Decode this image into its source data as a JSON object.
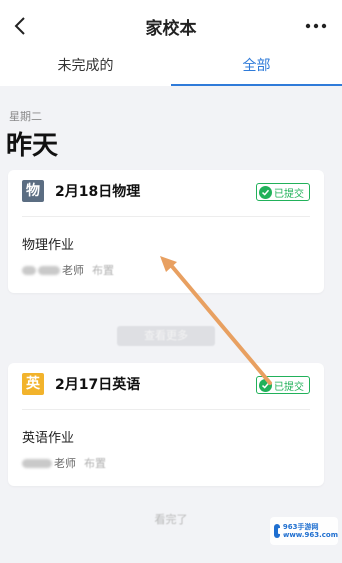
{
  "header": {
    "title": "家校本",
    "back_icon": "chevron-left-icon",
    "more_icon": "more-horizontal-icon"
  },
  "tabs": [
    {
      "label": "未完成的",
      "active": false
    },
    {
      "label": "全部",
      "active": true
    }
  ],
  "section": {
    "weekday": "星期二",
    "day": "昨天"
  },
  "cards": [
    {
      "badge": "物",
      "badge_color": "#5b6d82",
      "title": "2月18日物理",
      "status": "已提交",
      "homework": "物理作业",
      "teacher_suffix": "老师",
      "published": "布置"
    },
    {
      "badge": "英",
      "badge_color": "#f2b32c",
      "title": "2月17日英语",
      "status": "已提交",
      "homework": "英语作业",
      "teacher_suffix": "老师",
      "published": "布置"
    }
  ],
  "list": {
    "load_more": "查看更多",
    "end_text": "看完了"
  },
  "watermark": {
    "line1": "963手游网",
    "line2": "www.963.com"
  },
  "colors": {
    "accent": "#2f7bd9",
    "submitted": "#21b15a",
    "annotation_arrow": "#e8a061"
  }
}
